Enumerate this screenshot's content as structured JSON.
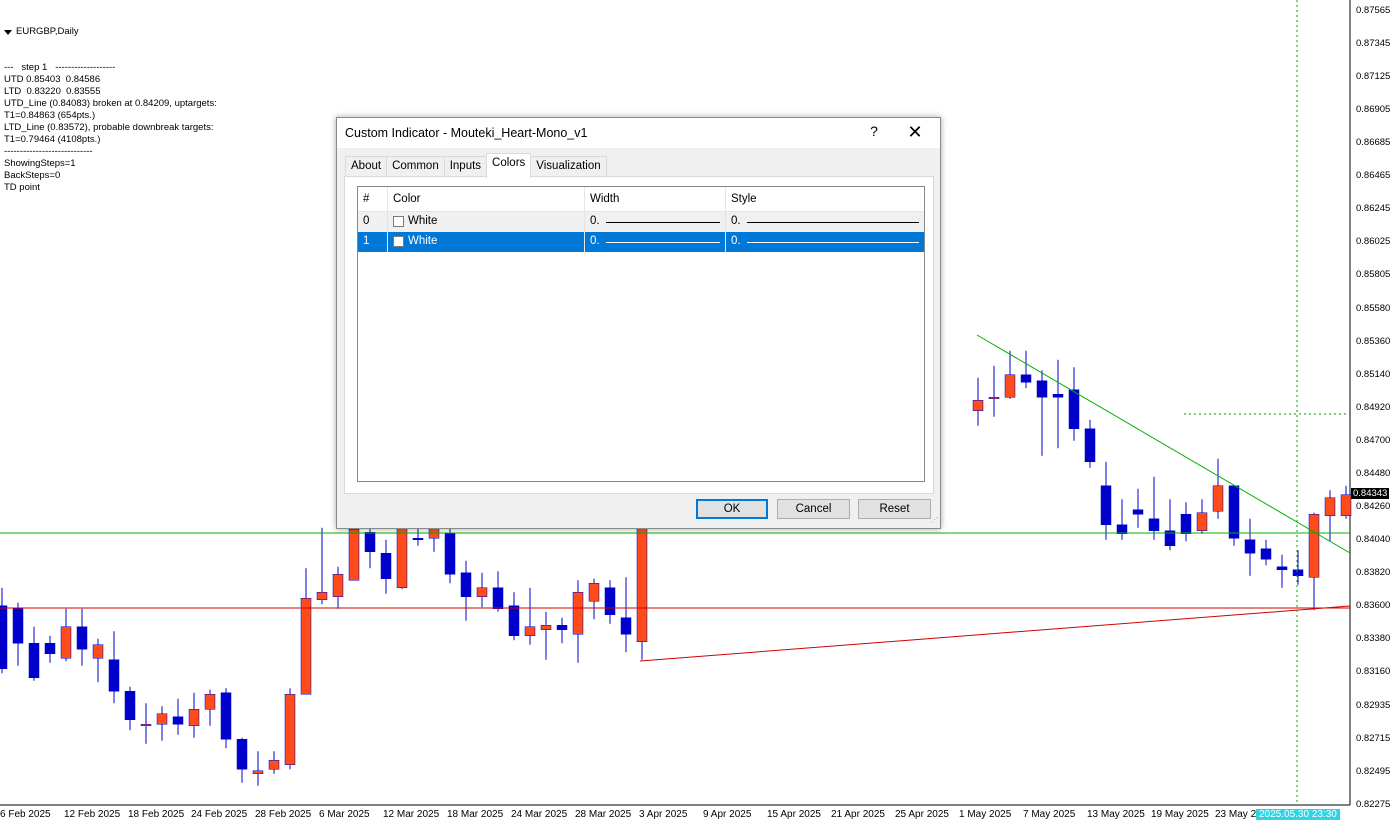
{
  "chart": {
    "symbol_label": "EURGBP,Daily",
    "info_lines": [
      "---   step 1   -------------------",
      "UTD 0.85403  0.84586",
      "LTD  0.83220  0.83555",
      "UTD_Line (0.84083) broken at 0.84209, uptargets:",
      "T1=0.84863 (654pts.)",
      "LTD_Line (0.83572), probable downbreak targets:",
      "T1=0.79464 (4108pts.)",
      "----------------------------",
      "ShowingSteps=1",
      "BackSteps=0",
      "TD point"
    ],
    "price_labels": [
      "0.87565",
      "0.87345",
      "0.87125",
      "0.86905",
      "0.86685",
      "0.86465",
      "0.86245",
      "0.86025",
      "0.85805",
      "0.85580",
      "0.85360",
      "0.85140",
      "0.84920",
      "0.84700",
      "0.84480",
      "0.84260",
      "0.84040",
      "0.83820",
      "0.83600",
      "0.83380",
      "0.83160",
      "0.82935",
      "0.82715",
      "0.82495",
      "0.82275"
    ],
    "current_price": "0.84343",
    "date_labels": [
      "6 Feb 2025",
      "12 Feb 2025",
      "18 Feb 2025",
      "24 Feb 2025",
      "28 Feb 2025",
      "6 Mar 2025",
      "12 Mar 2025",
      "18 Mar 2025",
      "24 Mar 2025",
      "28 Mar 2025",
      "3 Apr 2025",
      "9 Apr 2025",
      "15 Apr 2025",
      "21 Apr 2025",
      "25 Apr 2025",
      "1 May 2025",
      "7 May 2025",
      "13 May 2025",
      "19 May 2025",
      "23 May 2"
    ],
    "cursor_time": "2025.05.30 23:30",
    "colors": {
      "bull": "#ff4b1a",
      "bear": "#0000cc",
      "upper_line": "#00b000",
      "lower_line": "#d00000",
      "crosshair": "#00a000"
    },
    "candles": [
      {
        "o": 0.836,
        "h": 0.8372,
        "l": 0.8315,
        "c": 0.8318
      },
      {
        "o": 0.8358,
        "h": 0.8362,
        "l": 0.832,
        "c": 0.8335
      },
      {
        "o": 0.8335,
        "h": 0.8346,
        "l": 0.831,
        "c": 0.8312
      },
      {
        "o": 0.8335,
        "h": 0.834,
        "l": 0.8322,
        "c": 0.8328
      },
      {
        "o": 0.8325,
        "h": 0.8358,
        "l": 0.8323,
        "c": 0.8346
      },
      {
        "o": 0.8346,
        "h": 0.8358,
        "l": 0.832,
        "c": 0.8331
      },
      {
        "o": 0.8325,
        "h": 0.8338,
        "l": 0.8309,
        "c": 0.8334
      },
      {
        "o": 0.8324,
        "h": 0.8343,
        "l": 0.8295,
        "c": 0.8303
      },
      {
        "o": 0.8303,
        "h": 0.8306,
        "l": 0.8277,
        "c": 0.8284
      },
      {
        "o": 0.828,
        "h": 0.8295,
        "l": 0.8268,
        "c": 0.8281
      },
      {
        "o": 0.8281,
        "h": 0.8293,
        "l": 0.827,
        "c": 0.8288
      },
      {
        "o": 0.8286,
        "h": 0.8298,
        "l": 0.8274,
        "c": 0.8281
      },
      {
        "o": 0.828,
        "h": 0.8302,
        "l": 0.8272,
        "c": 0.8291
      },
      {
        "o": 0.8291,
        "h": 0.8304,
        "l": 0.828,
        "c": 0.8301
      },
      {
        "o": 0.8302,
        "h": 0.8305,
        "l": 0.8265,
        "c": 0.8271
      },
      {
        "o": 0.8271,
        "h": 0.8272,
        "l": 0.8242,
        "c": 0.8251
      },
      {
        "o": 0.8248,
        "h": 0.8263,
        "l": 0.824,
        "c": 0.825
      },
      {
        "o": 0.8251,
        "h": 0.8263,
        "l": 0.8248,
        "c": 0.8257
      },
      {
        "o": 0.8254,
        "h": 0.8305,
        "l": 0.8251,
        "c": 0.8301
      },
      {
        "o": 0.8301,
        "h": 0.8385,
        "l": 0.8301,
        "c": 0.8365
      },
      {
        "o": 0.8364,
        "h": 0.8412,
        "l": 0.8361,
        "c": 0.8369
      },
      {
        "o": 0.8366,
        "h": 0.8386,
        "l": 0.8358,
        "c": 0.8381
      },
      {
        "o": 0.8377,
        "h": 0.8418,
        "l": 0.8377,
        "c": 0.8411
      },
      {
        "o": 0.8409,
        "h": 0.842,
        "l": 0.8385,
        "c": 0.8396
      },
      {
        "o": 0.8395,
        "h": 0.8404,
        "l": 0.8368,
        "c": 0.8378
      },
      {
        "o": 0.8372,
        "h": 0.8415,
        "l": 0.8371,
        "c": 0.8414
      },
      {
        "o": 0.8405,
        "h": 0.8412,
        "l": 0.84,
        "c": 0.8404
      },
      {
        "o": 0.8405,
        "h": 0.8418,
        "l": 0.8396,
        "c": 0.8413
      },
      {
        "o": 0.8408,
        "h": 0.8412,
        "l": 0.8375,
        "c": 0.8381
      },
      {
        "o": 0.8382,
        "h": 0.839,
        "l": 0.835,
        "c": 0.8366
      },
      {
        "o": 0.8366,
        "h": 0.8382,
        "l": 0.8359,
        "c": 0.8372
      },
      {
        "o": 0.8372,
        "h": 0.8383,
        "l": 0.8356,
        "c": 0.8358
      },
      {
        "o": 0.836,
        "h": 0.8369,
        "l": 0.8337,
        "c": 0.834
      },
      {
        "o": 0.834,
        "h": 0.8372,
        "l": 0.8334,
        "c": 0.8346
      },
      {
        "o": 0.8344,
        "h": 0.8356,
        "l": 0.8324,
        "c": 0.8347
      },
      {
        "o": 0.8347,
        "h": 0.8352,
        "l": 0.8335,
        "c": 0.8344
      },
      {
        "o": 0.8341,
        "h": 0.8377,
        "l": 0.8322,
        "c": 0.8369
      },
      {
        "o": 0.8363,
        "h": 0.8378,
        "l": 0.8351,
        "c": 0.8375
      },
      {
        "o": 0.8372,
        "h": 0.8377,
        "l": 0.8348,
        "c": 0.8354
      },
      {
        "o": 0.8352,
        "h": 0.8379,
        "l": 0.8329,
        "c": 0.8341
      },
      {
        "o": 0.8336,
        "h": 0.842,
        "l": 0.8324,
        "c": 0.8415
      },
      {
        "o": null
      },
      {
        "o": null
      },
      {
        "o": null
      },
      {
        "o": null
      },
      {
        "o": null
      },
      {
        "o": null
      },
      {
        "o": null
      },
      {
        "o": null
      },
      {
        "o": null
      },
      {
        "o": null
      },
      {
        "o": null
      },
      {
        "o": null
      },
      {
        "o": null
      },
      {
        "o": null
      },
      {
        "o": null
      },
      {
        "o": null
      },
      {
        "o": null
      },
      {
        "o": null
      },
      {
        "o": null
      },
      {
        "o": null
      },
      {
        "o": 0.849,
        "h": 0.8512,
        "l": 0.848,
        "c": 0.8497
      },
      {
        "o": 0.8498,
        "h": 0.852,
        "l": 0.8486,
        "c": 0.8499
      },
      {
        "o": 0.8499,
        "h": 0.853,
        "l": 0.8498,
        "c": 0.8514
      },
      {
        "o": 0.8514,
        "h": 0.853,
        "l": 0.8505,
        "c": 0.8509
      },
      {
        "o": 0.851,
        "h": 0.8517,
        "l": 0.846,
        "c": 0.8499
      },
      {
        "o": 0.8501,
        "h": 0.8524,
        "l": 0.8465,
        "c": 0.8499
      },
      {
        "o": 0.8504,
        "h": 0.8519,
        "l": 0.847,
        "c": 0.8478
      },
      {
        "o": 0.8478,
        "h": 0.8484,
        "l": 0.8452,
        "c": 0.8456
      },
      {
        "o": 0.844,
        "h": 0.8456,
        "l": 0.8404,
        "c": 0.8414
      },
      {
        "o": 0.8414,
        "h": 0.8431,
        "l": 0.8404,
        "c": 0.8408
      },
      {
        "o": 0.8424,
        "h": 0.8438,
        "l": 0.8412,
        "c": 0.8421
      },
      {
        "o": 0.8418,
        "h": 0.8446,
        "l": 0.8404,
        "c": 0.841
      },
      {
        "o": 0.841,
        "h": 0.8431,
        "l": 0.8397,
        "c": 0.84
      },
      {
        "o": 0.8421,
        "h": 0.8429,
        "l": 0.8403,
        "c": 0.8408
      },
      {
        "o": 0.841,
        "h": 0.8431,
        "l": 0.8408,
        "c": 0.8422
      },
      {
        "o": 0.8423,
        "h": 0.8458,
        "l": 0.8418,
        "c": 0.844
      },
      {
        "o": 0.844,
        "h": 0.844,
        "l": 0.84,
        "c": 0.8405
      },
      {
        "o": 0.8404,
        "h": 0.8418,
        "l": 0.838,
        "c": 0.8395
      },
      {
        "o": 0.8398,
        "h": 0.8404,
        "l": 0.8387,
        "c": 0.8391
      },
      {
        "o": 0.8386,
        "h": 0.8394,
        "l": 0.8372,
        "c": 0.8384
      },
      {
        "o": 0.8384,
        "h": 0.8397,
        "l": 0.8374,
        "c": 0.838
      },
      {
        "o": 0.8379,
        "h": 0.8422,
        "l": 0.8357,
        "c": 0.8421
      },
      {
        "o": 0.842,
        "h": 0.8437,
        "l": 0.8403,
        "c": 0.8432
      },
      {
        "o": 0.842,
        "h": 0.844,
        "l": 0.8418,
        "c": 0.8434
      }
    ]
  },
  "dialog": {
    "title": "Custom Indicator - Mouteki_Heart-Mono_v1",
    "help": "?",
    "close": "✕",
    "tabs": [
      "About",
      "Common",
      "Inputs",
      "Colors",
      "Visualization"
    ],
    "active_tab": "Colors",
    "columns": [
      "#",
      "Color",
      "Width",
      "Style"
    ],
    "rows": [
      {
        "index": "0",
        "color": "White",
        "width": "0.",
        "style": "0."
      },
      {
        "index": "1",
        "color": "White",
        "width": "0.",
        "style": "0."
      }
    ],
    "selected_row": 1,
    "buttons": {
      "ok": "OK",
      "cancel": "Cancel",
      "reset": "Reset"
    }
  }
}
